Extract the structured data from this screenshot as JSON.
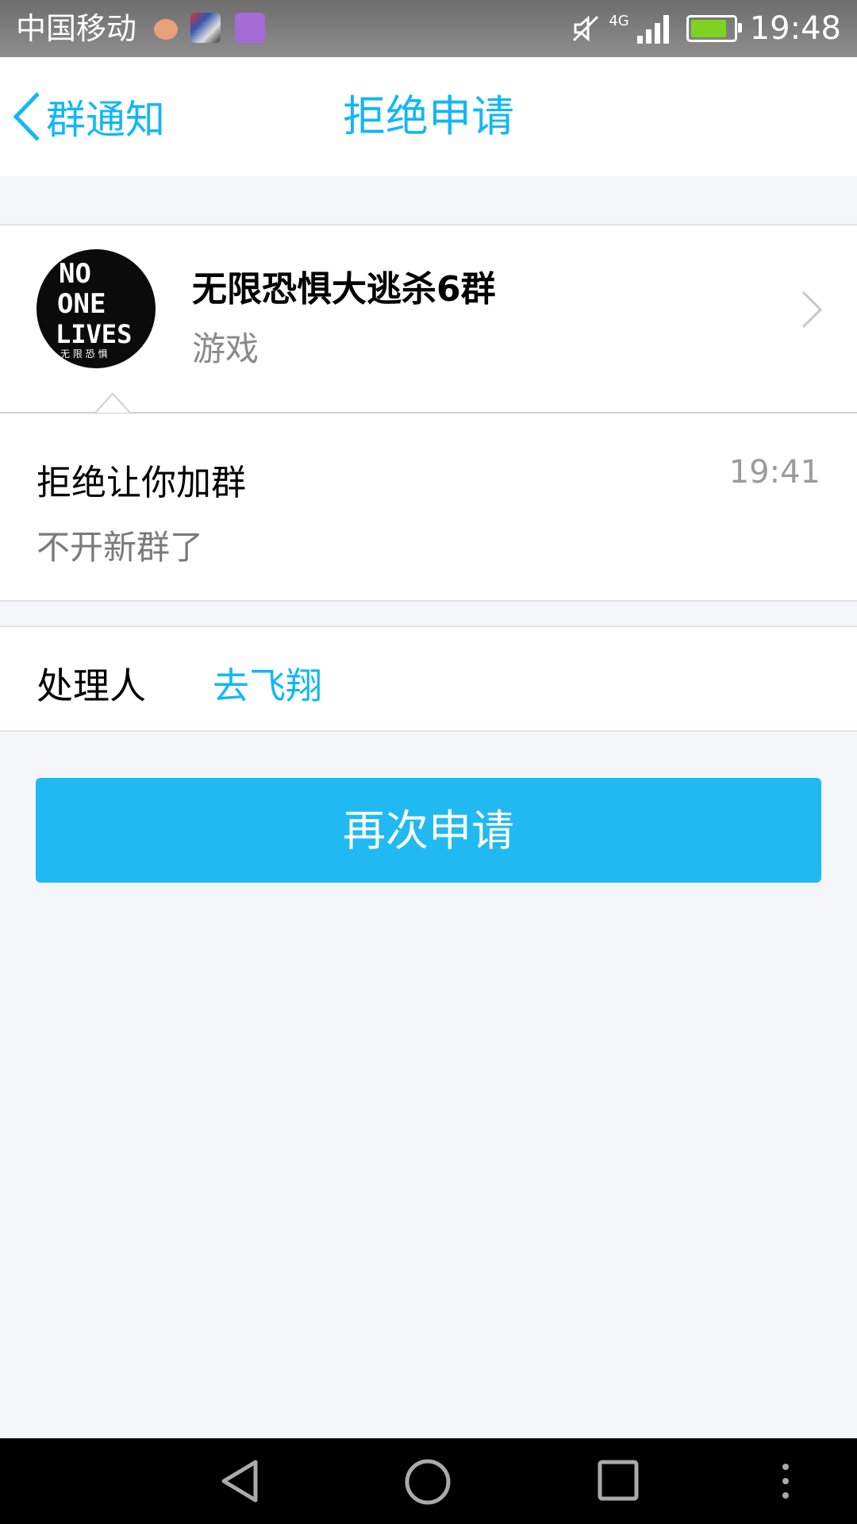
{
  "status_bar": {
    "carrier": "中国移动",
    "network": "4G",
    "time": "19:48",
    "battery_level_pct": 85
  },
  "nav": {
    "back_label": "群通知",
    "title": "拒绝申请"
  },
  "group": {
    "name": "无限恐惧大逃杀6群",
    "category": "游戏",
    "avatar_text": [
      "NO",
      "ONE",
      "LIVES",
      "无 限 恐 惧"
    ]
  },
  "message": {
    "title": "拒绝让你加群",
    "time": "19:41",
    "body": "不开新群了"
  },
  "handler": {
    "label": "处理人",
    "name": "去飞翔"
  },
  "actions": {
    "reapply_label": "再次申请"
  },
  "colors": {
    "accent": "#12b7f5",
    "button": "#21b9f2",
    "background": "#f5f6fa"
  }
}
